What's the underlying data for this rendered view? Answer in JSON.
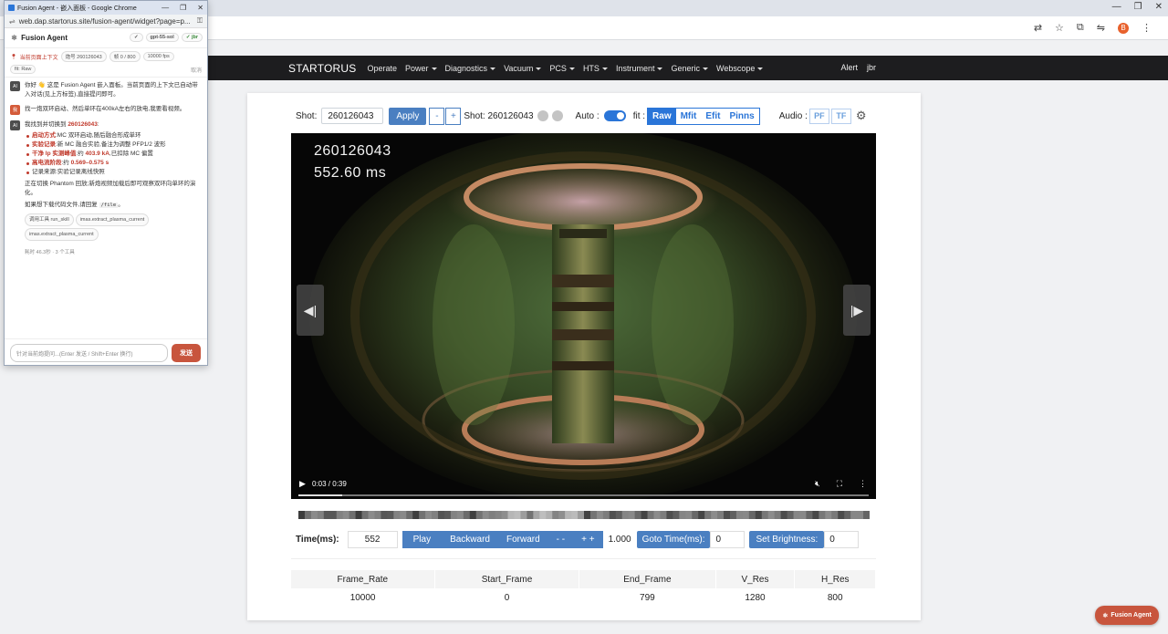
{
  "browser": {
    "omni_icons": [
      "translate-icon",
      "star-icon",
      "extension-icon",
      "profile-icon",
      "menu-icon"
    ],
    "avatar_letter": "B"
  },
  "navbar": {
    "brand": "STARTORUS",
    "items": [
      {
        "label": "Operate",
        "dropdown": false
      },
      {
        "label": "Power",
        "dropdown": true
      },
      {
        "label": "Diagnostics",
        "dropdown": true
      },
      {
        "label": "Vacuum",
        "dropdown": true
      },
      {
        "label": "PCS",
        "dropdown": true
      },
      {
        "label": "HTS",
        "dropdown": true
      },
      {
        "label": "Instrument",
        "dropdown": true
      },
      {
        "label": "Generic",
        "dropdown": true
      },
      {
        "label": "Webscope",
        "dropdown": true
      }
    ],
    "alert": "Alert",
    "user": "jbr"
  },
  "controls": {
    "shot_label": "Shot:",
    "shot_value": "260126043",
    "apply": "Apply",
    "minus": "-",
    "plus": "+",
    "shot_display": "Shot: 260126043",
    "auto_label": "Auto :",
    "auto_on": true,
    "fit_label": "fit :",
    "fit_options": [
      "Raw",
      "Mfit",
      "Efit",
      "Pinns"
    ],
    "fit_selected": "Raw",
    "audio_label": "Audio :",
    "audio_options": [
      "PF",
      "TF"
    ]
  },
  "video": {
    "overlay_shot": "260126043",
    "overlay_time": "552.60 ms",
    "time_display": "0:03 / 0:39",
    "progress": 0.077,
    "prev_arrow": "◀|",
    "next_arrow": "|▶"
  },
  "time_controls": {
    "label": "Time(ms):",
    "time_value": "552",
    "play": "Play",
    "backward": "Backward",
    "forward": "Forward",
    "slower": "- -",
    "faster": "+ +",
    "speed": "1.000",
    "goto_label": "Goto Time(ms):",
    "goto_value": "0",
    "brightness_label": "Set Brightness:",
    "brightness_value": "0"
  },
  "info_table": {
    "headers": [
      "Frame_Rate",
      "Start_Frame",
      "End_Frame",
      "V_Res",
      "H_Res"
    ],
    "row": [
      "10000",
      "0",
      "799",
      "1280",
      "800"
    ]
  },
  "popup": {
    "window_title": "Fusion Agent - 嵌入面板 - Google Chrome",
    "url": "web.dap.startorus.site/fusion-agent/widget?page=p...",
    "header": "Fusion Agent",
    "model_chip": "gpt-55-sol",
    "user_chip": "✓ jbr",
    "context": {
      "label": "当前页面上下文",
      "chips": [
        "炮号 260126043",
        "帧 0 / 800",
        "10000 fps",
        "fit: Raw"
      ],
      "cancel": "取消"
    },
    "messages": [
      {
        "role": "AI",
        "text": "你好 👋 这是 Fusion Agent 嵌入面板。当前页面的上下文已自动带入对话(见上方标签),直接提问即可。"
      },
      {
        "role": "我",
        "text": "找一炮双环启动、然后单环在400kA左右的放电,我要看视频。"
      },
      {
        "role": "AI",
        "intro_prefix": "我找到并切换到 ",
        "intro_shot": "260126043",
        "intro_suffix": ":",
        "bullets": [
          {
            "key": "启动方式",
            "value": ":MC 双环启动,随后融合形成单环"
          },
          {
            "key": "实验记录",
            "value": ":新 MC 融合实验,备注为调整 PFP1/2 波形"
          },
          {
            "key": "干净 Ip 实测峰值",
            "value_prefix": ":约 ",
            "value_hl": "403.9 kA",
            "value_suffix": ",已扣除 MC 偏置"
          },
          {
            "key": "高电流阶段",
            "value_prefix": ":约 ",
            "value_hl": "0.569–0.575 s",
            "value_suffix": ""
          },
          {
            "key": "",
            "value": "记录来源:实验记录离线快照"
          }
        ],
        "para1": "正在切换 Phantom 回放;新炮视频加载后即可观察双环向单环的演化。",
        "para2_prefix": "如果想下载代码文件,请回复 ",
        "para2_code": "/file",
        "para2_suffix": "。",
        "tools": [
          "调用工具 run_skill",
          "imas.extract_plasma_current",
          "imas.extract_plasma_current"
        ],
        "footer": "耗时 46.3秒 · 3 个工具"
      }
    ],
    "input_placeholder": "针对当前炮提问...(Enter 发送 / Shift+Enter 换行)",
    "send": "发送"
  },
  "fab": "Fusion Agent",
  "colors": {
    "primary": "#4a7fc1",
    "fit_blue": "#2a75d8",
    "agent_red": "#c8553d",
    "navbar": "#1d1d1f"
  }
}
